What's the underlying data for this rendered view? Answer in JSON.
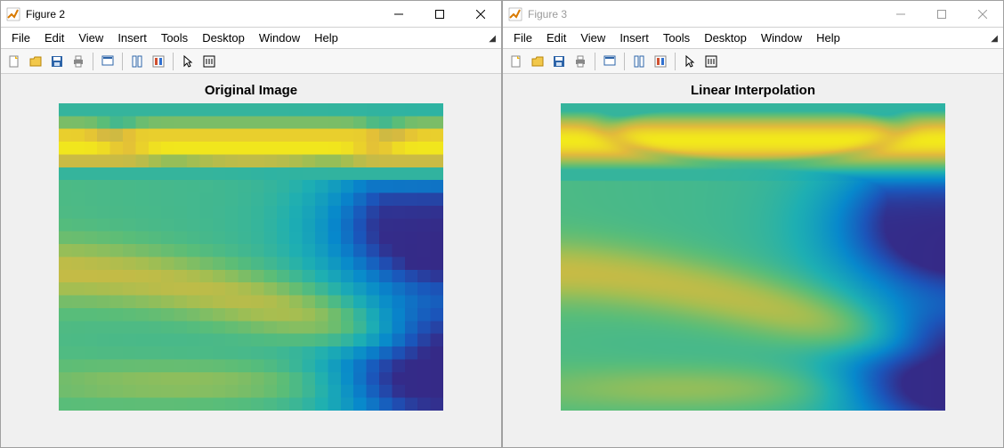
{
  "windows": [
    {
      "id": "fig2",
      "active": true,
      "title": "Figure 2",
      "plot_title": "Original Image",
      "blur": false,
      "pixelated": true
    },
    {
      "id": "fig3",
      "active": false,
      "title": "Figure 3",
      "plot_title": "Linear Interpolation",
      "blur": true,
      "pixelated": false
    }
  ],
  "menus": [
    "File",
    "Edit",
    "View",
    "Insert",
    "Tools",
    "Desktop",
    "Window",
    "Help"
  ],
  "toolbar_groups": [
    [
      "new-file-icon",
      "open-folder-icon",
      "save-icon",
      "print-icon"
    ],
    [
      "data-cursor-icon"
    ],
    [
      "link-axes-icon",
      "insert-colorbar-icon"
    ],
    [
      "pointer-icon",
      "edit-plot-icon"
    ]
  ],
  "icon_colors": {
    "new-file-icon": "#f2b200",
    "open-folder-icon": "#f2b200",
    "save-icon": "#2d64a8",
    "print-icon": "#666666",
    "data-cursor-icon": "#2d64a8",
    "link-axes-icon": "#2d64a8",
    "insert-colorbar-icon": "#d05030",
    "pointer-icon": "#000000",
    "edit-plot-icon": "#000000"
  },
  "chart_data": {
    "type": "heatmap",
    "note": "Two renderings of the same 2-D scalar field; left = blocky low-res, right = linearly interpolated smooth version. Colormap ≈ MATLAB parula (deep blue → teal → green → yellow).",
    "grid_size": [
      30,
      24
    ],
    "value_range": [
      0.0,
      1.0
    ],
    "colormap_hint": "parula",
    "field_description": {
      "top_band": "high values (~0.85–1.0, yellow) spanning full width in upper ~25% of image, with a slightly darker elongated ring/halo near the very top",
      "right_edge_mid": "low values (~0.0–0.15, deep blue/purple) in a wedge along the right edge from ~25% to ~55% height",
      "bottom_right": "another deep-blue wedge in the lower-right corner",
      "center_left": "broad mid values (~0.45–0.6, teal/green) filling most of the lower two-thirds",
      "diagonal_ridge": "a curved ridge of slightly elevated values (~0.6–0.7, yellow-green) sweeping from left-center toward lower-right, splitting the two blue wedges"
    }
  }
}
